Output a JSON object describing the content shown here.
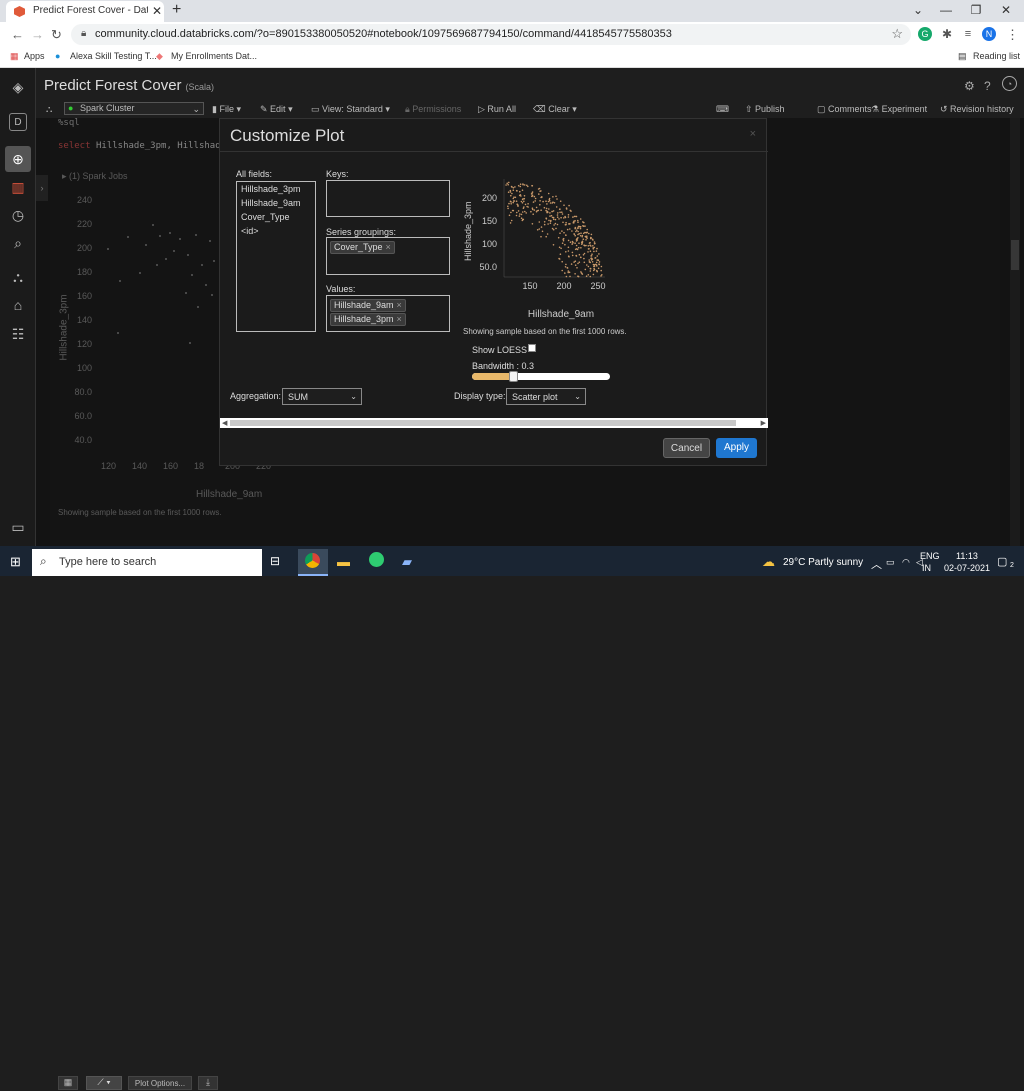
{
  "browser": {
    "tab_title": "Predict Forest Cover - Databricks",
    "url": "community.cloud.databricks.com/?o=890153380050520#notebook/1097569687794150/command/4418545775580353",
    "bookmarks": [
      "Apps",
      "Alexa Skill Testing T...",
      "My Enrollments Dat..."
    ],
    "reading_list": "Reading list",
    "profile_initial": "N"
  },
  "notebook": {
    "title": "Predict Forest Cover",
    "language": "(Scala)",
    "cluster": "Spark Cluster",
    "toolbar": {
      "file": "File",
      "edit": "Edit",
      "view": "View: Standard",
      "permissions": "Permissions",
      "run_all": "Run All",
      "clear": "Clear",
      "publish": "Publish",
      "comments": "Comments",
      "experiment": "Experiment",
      "revision_history": "Revision history"
    },
    "cell": {
      "magic": "%sql",
      "code_keyword": "select",
      "code_rest": "Hillshade_3pm, Hillshade",
      "spark_jobs": "(1) Spark Jobs",
      "y_label": "Hillshade_3pm",
      "x_label": "Hillshade_9am",
      "y_ticks": [
        "240",
        "220",
        "200",
        "180",
        "160",
        "140",
        "120",
        "100",
        "80.0",
        "60.0",
        "40.0"
      ],
      "x_ticks": [
        "120",
        "140",
        "160",
        "18",
        "200",
        "220"
      ],
      "sample_note": "Showing sample based on the first 1000 rows.",
      "plot_options": "Plot Options..."
    }
  },
  "modal": {
    "title": "Customize Plot",
    "close": "×",
    "all_fields_label": "All fields:",
    "all_fields": [
      "Hillshade_3pm",
      "Hillshade_9am",
      "Cover_Type",
      "<id>"
    ],
    "keys_label": "Keys:",
    "series_label": "Series groupings:",
    "series_chips": [
      "Cover_Type"
    ],
    "values_label": "Values:",
    "values_chips": [
      "Hillshade_9am",
      "Hillshade_3pm"
    ],
    "chip_remove": "×",
    "preview": {
      "y_label": "Hillshade_3pm",
      "x_label": "Hillshade_9am",
      "y_ticks": [
        "200",
        "150",
        "100",
        "50.0"
      ],
      "x_ticks": [
        "150",
        "200",
        "250"
      ],
      "sample_note": "Showing sample based on the first 1000 rows."
    },
    "show_loess_label": "Show LOESS",
    "show_loess_checked": false,
    "bandwidth_label": "Bandwidth : 0.3",
    "bandwidth_value": 0.3,
    "aggregation_label": "Aggregation:",
    "aggregation_value": "SUM",
    "display_type_label": "Display type:",
    "display_type_value": "Scatter plot",
    "cancel": "Cancel",
    "apply": "Apply",
    "accent": "#1f77d0"
  },
  "taskbar": {
    "search_placeholder": "Type here to search",
    "weather": "29°C  Partly sunny",
    "lang": "ENG",
    "region": "IN",
    "time": "11:13",
    "date": "02-07-2021",
    "notifications": "2"
  }
}
